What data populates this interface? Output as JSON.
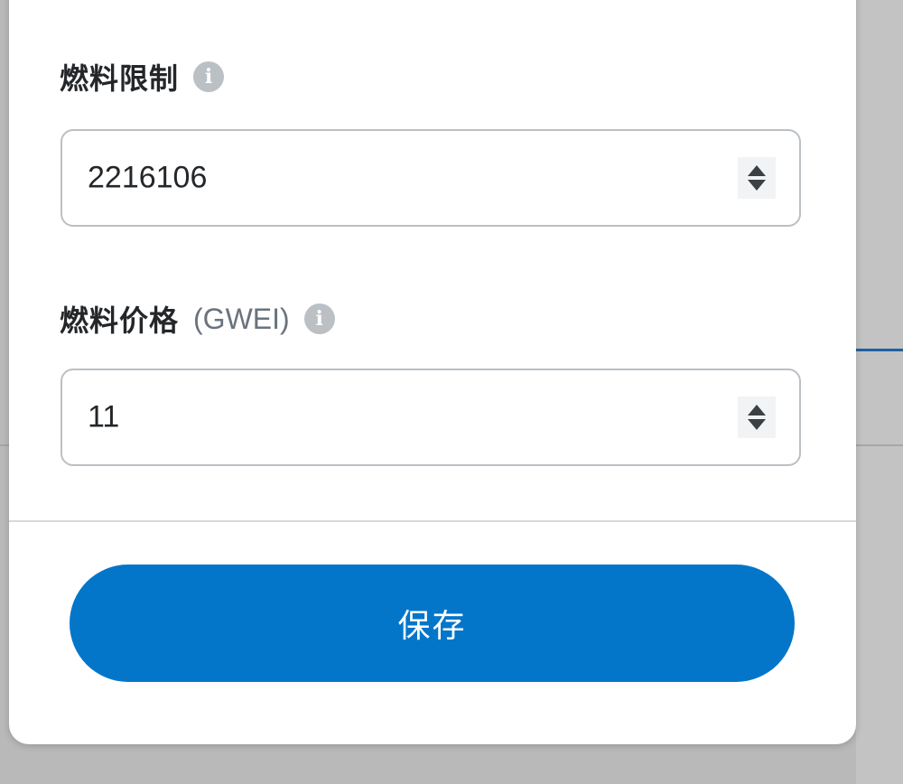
{
  "gas_limit": {
    "label": "燃料限制",
    "value": "2216106",
    "info_icon": "info-icon"
  },
  "gas_price": {
    "label": "燃料价格",
    "unit": "(GWEI)",
    "value": "11",
    "info_icon": "info-icon"
  },
  "footer": {
    "save_label": "保存"
  },
  "colors": {
    "primary": "#0376c9",
    "border": "#bbc0c5",
    "text": "#24272a",
    "muted": "#6a737d"
  }
}
